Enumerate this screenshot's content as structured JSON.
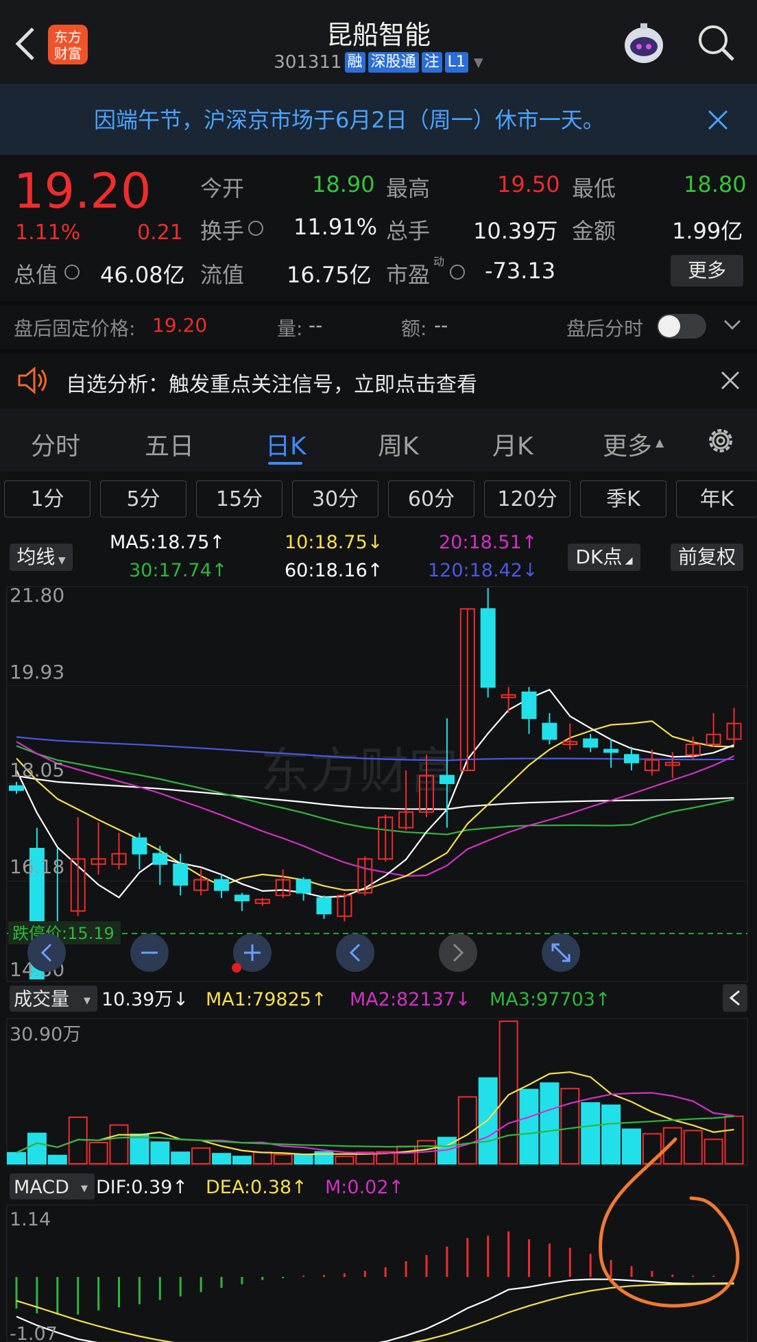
{
  "header": {
    "title": "昆船智能",
    "code": "301311",
    "tags": [
      "融",
      "深股通",
      "注",
      "L1"
    ]
  },
  "banner": {
    "text": "因端午节，沪深京市场于6月2日（周一）休市一天。"
  },
  "quote": {
    "price": "19.20",
    "change_pct": "1.11%",
    "change": "0.21",
    "open_label": "今开",
    "open": "18.90",
    "high_label": "最高",
    "high": "19.50",
    "low_label": "最低",
    "low": "18.80",
    "turnover_label": "换手",
    "turnover": "11.91%",
    "volume_label": "总手",
    "volume": "10.39万",
    "amount_label": "金额",
    "amount": "1.99亿",
    "mktcap_label": "总值",
    "mktcap": "46.08亿",
    "float_label": "流值",
    "float": "16.75亿",
    "pe_label": "市盈",
    "pe_sup": "动",
    "pe": "-73.13",
    "more": "更多"
  },
  "after_hours": {
    "label": "盘后固定价格:",
    "price": "19.20",
    "vol_label": "量:",
    "vol": "--",
    "amt_label": "额:",
    "amt": "--",
    "toggle_label": "盘后分时"
  },
  "alert": {
    "text": "自选分析：触发重点关注信号，立即点击查看"
  },
  "tabs": [
    "分时",
    "五日",
    "日K",
    "周K",
    "月K",
    "更多"
  ],
  "periods": [
    "1分",
    "5分",
    "15分",
    "30分",
    "60分",
    "120分",
    "季K",
    "年K"
  ],
  "ma": {
    "selector": "均线",
    "ma5": "MA5:18.75↑",
    "ma10": "10:18.75↓",
    "ma20": "20:18.51↑",
    "ma30": "30:17.74↑",
    "ma60": "60:18.16↑",
    "ma120": "120:18.42↓",
    "dk": "DK点",
    "fq": "前复权"
  },
  "kline": {
    "y_labels": [
      "21.80",
      "19.93",
      "18.05",
      "16.18",
      "14.30"
    ],
    "limit_down": "跌停价:15.19",
    "watermark": "东方财富"
  },
  "volume": {
    "selector": "成交量",
    "value": "10.39万↓",
    "ma1": "MA1:79825↑",
    "ma2": "MA2:82137↓",
    "ma3": "MA3:97703↑",
    "y_label": "30.90万"
  },
  "macd": {
    "selector": "MACD",
    "dif": "DIF:0.39↑",
    "dea": "DEA:0.38↑",
    "m": "M:0.02↑",
    "y_top": "1.14",
    "y_bottom": "-1.07"
  },
  "colors": {
    "up": "#f02c2c",
    "down": "#22e0ea",
    "ma5": "#ffffff",
    "ma10": "#f5e04a",
    "ma20": "#d430c8",
    "ma30": "#2db83b",
    "ma60": "#ffffff",
    "ma120": "#4a5ae0"
  },
  "chart_data": {
    "type": "candlestick",
    "y_range": [
      14.3,
      21.8
    ],
    "candles": [
      {
        "o": 18.0,
        "c": 17.92,
        "h": 18.08,
        "l": 17.85
      },
      {
        "o": 16.8,
        "c": 14.3,
        "h": 17.2,
        "l": 14.3
      },
      {
        "o": 15.2,
        "c": 15.1,
        "h": 16.8,
        "l": 14.9
      },
      {
        "o": 15.6,
        "c": 16.6,
        "h": 17.4,
        "l": 15.5
      },
      {
        "o": 16.5,
        "c": 16.6,
        "h": 17.3,
        "l": 16.3
      },
      {
        "o": 16.5,
        "c": 16.7,
        "h": 17.1,
        "l": 16.4
      },
      {
        "o": 17.0,
        "c": 16.7,
        "h": 17.1,
        "l": 16.4
      },
      {
        "o": 16.7,
        "c": 16.5,
        "h": 16.85,
        "l": 16.1
      },
      {
        "o": 16.5,
        "c": 16.1,
        "h": 16.7,
        "l": 15.9
      },
      {
        "o": 16.0,
        "c": 16.2,
        "h": 16.4,
        "l": 15.9
      },
      {
        "o": 16.2,
        "c": 16.0,
        "h": 16.3,
        "l": 15.85
      },
      {
        "o": 15.9,
        "c": 15.8,
        "h": 15.95,
        "l": 15.6
      },
      {
        "o": 15.75,
        "c": 15.82,
        "h": 15.85,
        "l": 15.7
      },
      {
        "o": 15.9,
        "c": 16.2,
        "h": 16.4,
        "l": 15.85
      },
      {
        "o": 16.2,
        "c": 15.95,
        "h": 16.25,
        "l": 15.8
      },
      {
        "o": 15.85,
        "c": 15.55,
        "h": 15.9,
        "l": 15.45
      },
      {
        "o": 15.5,
        "c": 15.9,
        "h": 15.95,
        "l": 15.4
      },
      {
        "o": 15.95,
        "c": 16.6,
        "h": 16.65,
        "l": 15.9
      },
      {
        "o": 16.6,
        "c": 17.4,
        "h": 17.45,
        "l": 16.55
      },
      {
        "o": 17.2,
        "c": 17.5,
        "h": 18.3,
        "l": 17.15
      },
      {
        "o": 17.5,
        "c": 18.2,
        "h": 18.6,
        "l": 17.4
      },
      {
        "o": 18.2,
        "c": 18.05,
        "h": 19.3,
        "l": 17.2
      },
      {
        "o": 18.3,
        "c": 21.4,
        "h": 21.4,
        "l": 18.3
      },
      {
        "o": 21.4,
        "c": 19.9,
        "h": 21.8,
        "l": 19.7
      },
      {
        "o": 19.7,
        "c": 19.75,
        "h": 19.9,
        "l": 19.4
      },
      {
        "o": 19.8,
        "c": 19.3,
        "h": 19.9,
        "l": 19.0
      },
      {
        "o": 19.2,
        "c": 18.9,
        "h": 19.4,
        "l": 18.8
      },
      {
        "o": 18.8,
        "c": 18.85,
        "h": 19.2,
        "l": 18.7
      },
      {
        "o": 18.9,
        "c": 18.75,
        "h": 19.0,
        "l": 18.65
      },
      {
        "o": 18.7,
        "c": 18.65,
        "h": 18.9,
        "l": 18.35
      },
      {
        "o": 18.6,
        "c": 18.45,
        "h": 18.75,
        "l": 18.3
      },
      {
        "o": 18.3,
        "c": 18.5,
        "h": 18.7,
        "l": 18.2
      },
      {
        "o": 18.4,
        "c": 18.45,
        "h": 18.65,
        "l": 18.15
      },
      {
        "o": 18.6,
        "c": 18.8,
        "h": 18.95,
        "l": 18.5
      },
      {
        "o": 18.8,
        "c": 18.99,
        "h": 19.4,
        "l": 18.75
      },
      {
        "o": 18.9,
        "c": 19.2,
        "h": 19.5,
        "l": 18.8
      }
    ],
    "volume_range": [
      0,
      30.9
    ],
    "volumes": [
      2.4,
      6.6,
      1.8,
      10.1,
      4.6,
      8.4,
      6.4,
      4.7,
      2.5,
      3.4,
      2.2,
      1.6,
      2.5,
      2.0,
      1.9,
      2.6,
      1.6,
      2.5,
      2.6,
      3.8,
      5.0,
      5.7,
      14.5,
      18.6,
      30.9,
      16.1,
      17.5,
      16.3,
      13.2,
      12.7,
      7.5,
      6.5,
      7.8,
      7.2,
      5.3,
      10.3
    ],
    "macd_range": [
      -1.07,
      1.14
    ],
    "macd_hist": [
      -0.52,
      -0.6,
      -0.62,
      -0.62,
      -0.55,
      -0.5,
      -0.45,
      -0.38,
      -0.32,
      -0.25,
      -0.18,
      -0.12,
      -0.05,
      -0.02,
      0.02,
      0.03,
      0.06,
      0.1,
      0.16,
      0.26,
      0.36,
      0.5,
      0.64,
      0.68,
      0.75,
      0.62,
      0.55,
      0.48,
      0.38,
      0.28,
      0.18,
      0.1,
      0.04,
      0.02,
      0.02,
      0.02
    ]
  }
}
